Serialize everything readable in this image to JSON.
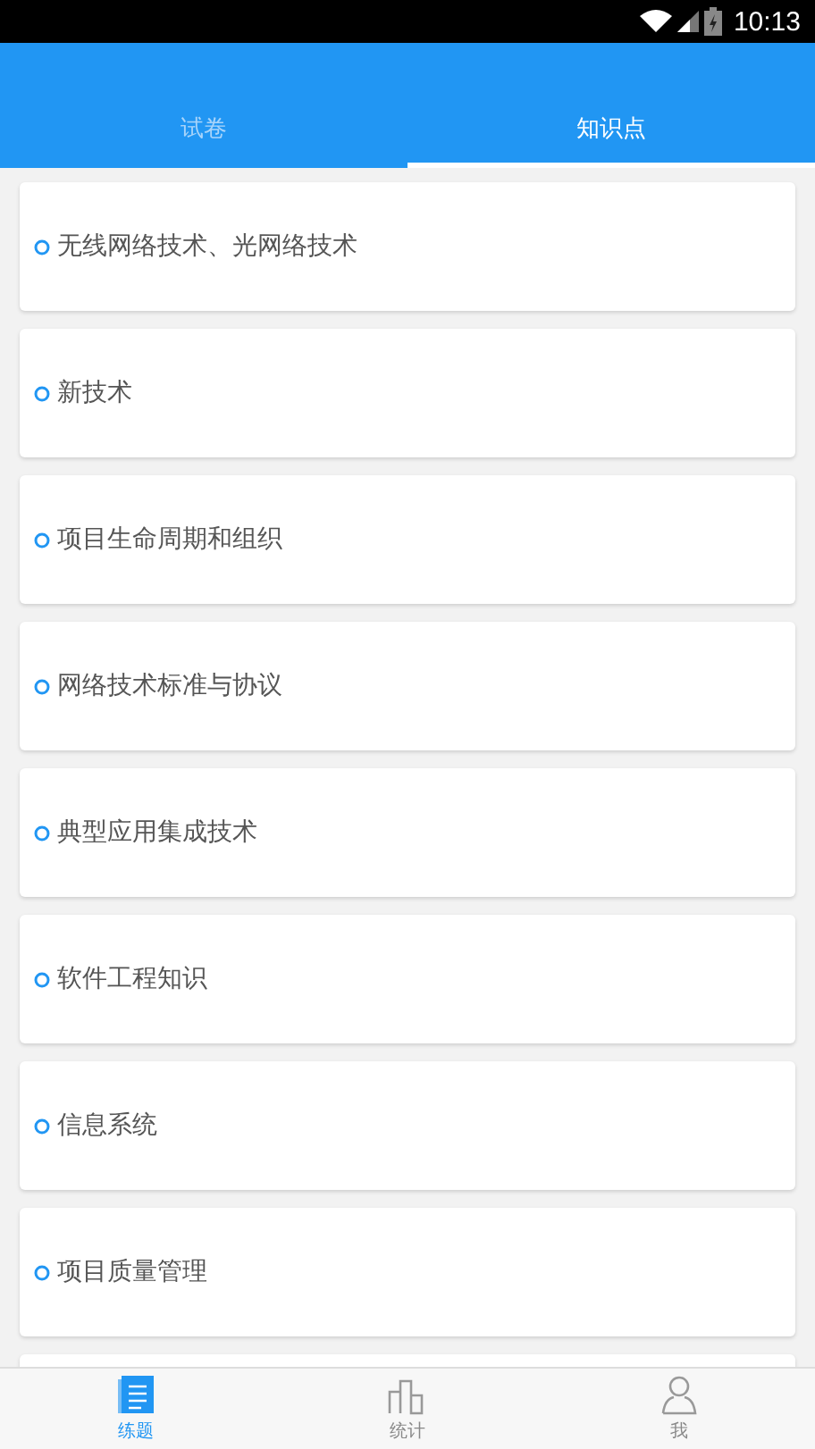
{
  "status_bar": {
    "time": "10:13"
  },
  "tabs": [
    {
      "label": "试卷",
      "selected": false
    },
    {
      "label": "知识点",
      "selected": true
    }
  ],
  "topics": [
    "无线网络技术、光网络技术",
    "新技术",
    "项目生命周期和组织",
    "网络技术标准与协议",
    "典型应用集成技术",
    "软件工程知识",
    "信息系统",
    "项目质量管理"
  ],
  "bottom_nav": [
    {
      "label": "练题",
      "kind": "book",
      "selected": true
    },
    {
      "label": "统计",
      "kind": "chart",
      "selected": false
    },
    {
      "label": "我",
      "kind": "person",
      "selected": false
    }
  ]
}
